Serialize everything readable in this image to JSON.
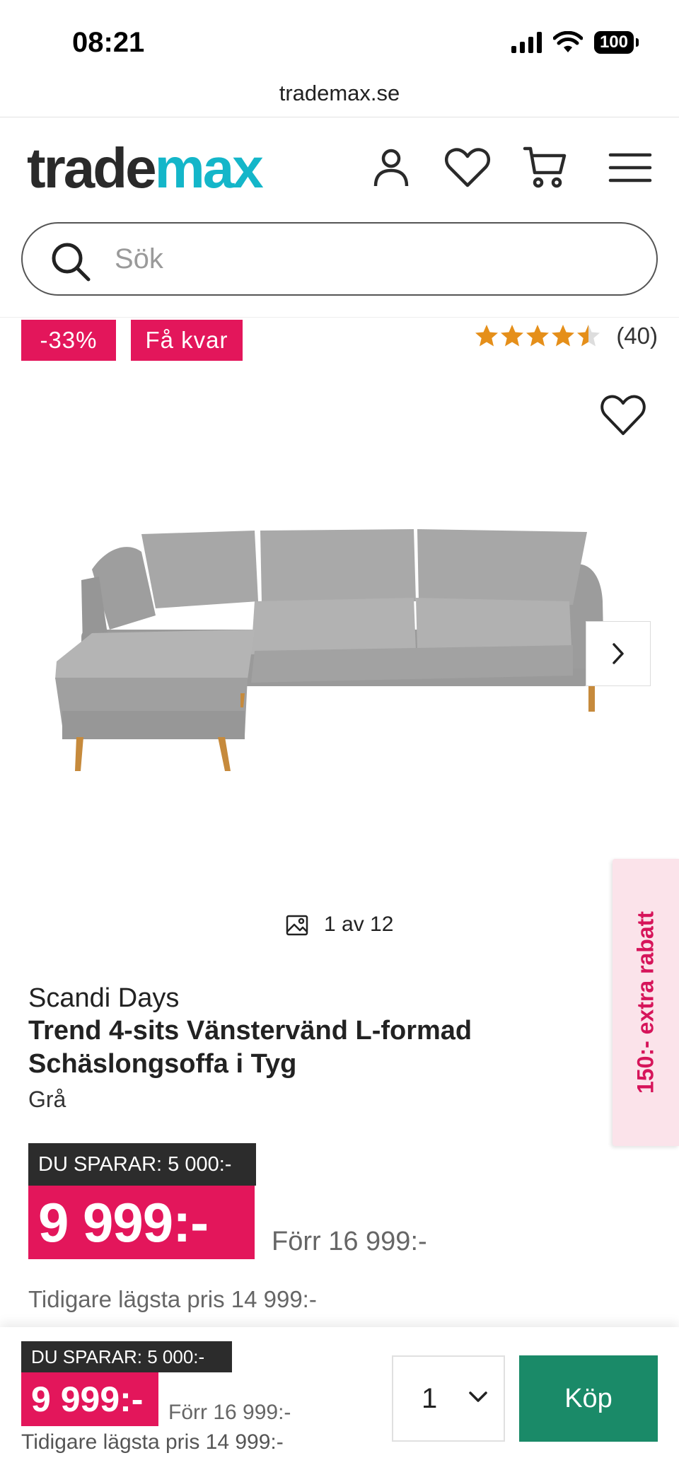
{
  "status_bar": {
    "time": "08:21",
    "battery": "100"
  },
  "browser": {
    "url": "trademax.se"
  },
  "header": {
    "logo_part1": "trade",
    "logo_part2": "max",
    "icons": [
      "user-icon",
      "heart-icon",
      "cart-icon",
      "menu-icon"
    ]
  },
  "search": {
    "placeholder": "Sök"
  },
  "badges": {
    "discount": "-33%",
    "stock": "Få kvar"
  },
  "rating": {
    "stars": 4.5,
    "max": 5,
    "count": "(40)"
  },
  "gallery": {
    "counter": "1 av 12"
  },
  "side_tab": {
    "label": "150:- extra rabatt"
  },
  "product": {
    "brand": "Scandi Days",
    "title": "Trend 4-sits Vänstervänd L-formad Schäslongsoffa i Tyg",
    "color": "Grå",
    "save_label": "DU SPARAR: 5 000:-",
    "price": "9 999:-",
    "old_price": "Förr 16 999:-",
    "lowest_price": "Tidigare lägsta pris 14 999:-"
  },
  "sticky": {
    "save_label": "DU SPARAR: 5 000:-",
    "price": "9 999:-",
    "old_price": "Förr 16 999:-",
    "lowest_price": "Tidigare lägsta pris 14 999:-",
    "quantity": "1",
    "buy_label": "Köp"
  },
  "colors": {
    "brand_teal": "#14b6c9",
    "sale_pink": "#e3165b",
    "buy_green": "#1a8a68",
    "star_orange": "#e58f1a"
  }
}
